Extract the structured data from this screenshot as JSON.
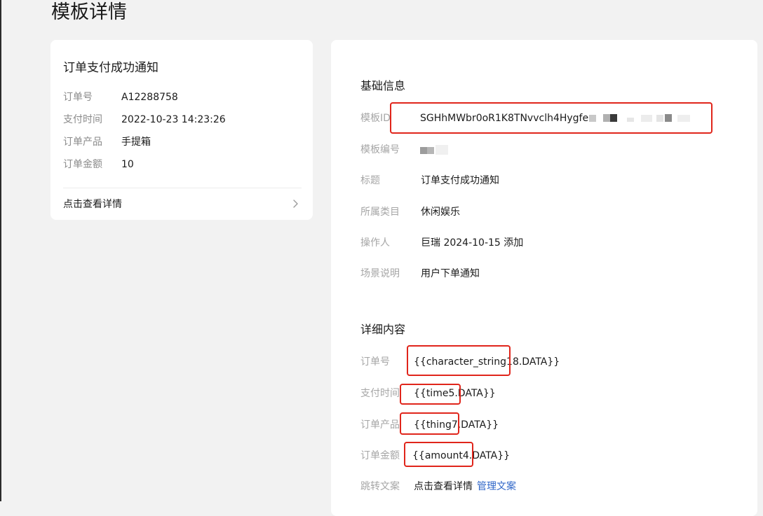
{
  "page": {
    "title": "模板详情"
  },
  "order_card": {
    "title": "订单支付成功通知",
    "rows": [
      {
        "label": "订单号",
        "value": "A12288758"
      },
      {
        "label": "支付时间",
        "value": "2022-10-23 14:23:26"
      },
      {
        "label": "订单产品",
        "value": "手提箱"
      },
      {
        "label": "订单金额",
        "value": "10"
      }
    ],
    "link_label": "点击查看详情",
    "link_icon": "chevron-right-icon"
  },
  "basic_info": {
    "title": "基础信息",
    "template_id": {
      "label": "模板ID",
      "value": "SGHhMWbr0oR1K8TNvvclh4Hygfe"
    },
    "template_no": {
      "label": "模板编号"
    },
    "title_field": {
      "label": "标题",
      "value": "订单支付成功通知"
    },
    "category": {
      "label": "所属类目",
      "value": "休闲娱乐"
    },
    "operator": {
      "label": "操作人",
      "value": "巨瑞 2024-10-15 添加"
    },
    "scene": {
      "label": "场景说明",
      "value": "用户下单通知"
    }
  },
  "detail": {
    "title": "详细内容",
    "rows": [
      {
        "label": "订单号",
        "value": "{{character_string18.DATA}}"
      },
      {
        "label": "支付时间",
        "value": "{{time5.DATA}}"
      },
      {
        "label": "订单产品",
        "value": "{{thing7.DATA}}"
      },
      {
        "label": "订单金额",
        "value": "{{amount4.DATA}}"
      }
    ],
    "jump": {
      "label": "跳转文案",
      "value": "点击查看详情",
      "manage_label": "管理文案"
    }
  },
  "colors": {
    "highlight": "#e0251b",
    "link": "#2f66c8"
  }
}
